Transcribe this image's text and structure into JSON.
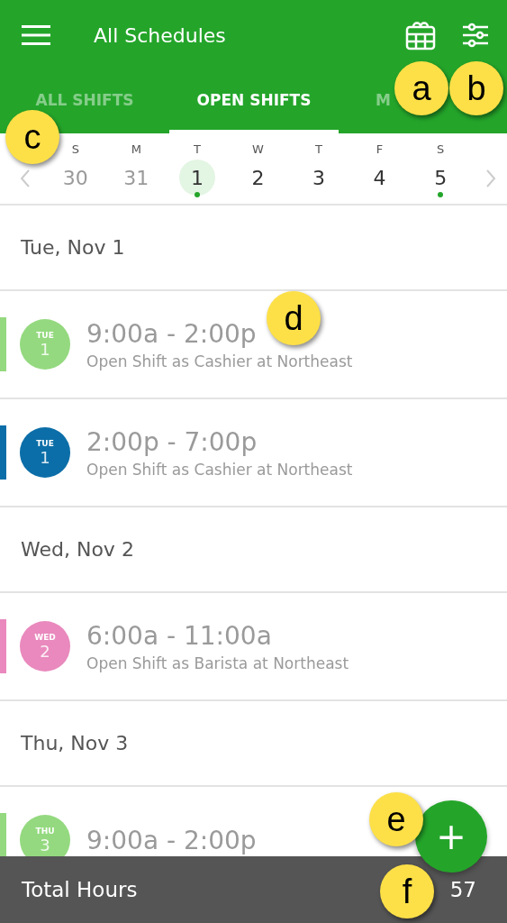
{
  "app_bar": {
    "title": "All Schedules"
  },
  "tabs": [
    {
      "label": "ALL SHIFTS",
      "selected": false
    },
    {
      "label": "OPEN SHIFTS",
      "selected": true
    },
    {
      "label": "M",
      "selected": false
    }
  ],
  "week": [
    {
      "letter": "S",
      "day": "30",
      "past": true,
      "selected": false,
      "has_shift": false
    },
    {
      "letter": "M",
      "day": "31",
      "past": true,
      "selected": false,
      "has_shift": false
    },
    {
      "letter": "T",
      "day": "1",
      "past": false,
      "selected": true,
      "has_shift": true
    },
    {
      "letter": "W",
      "day": "2",
      "past": false,
      "selected": false,
      "has_shift": false
    },
    {
      "letter": "T",
      "day": "3",
      "past": false,
      "selected": false,
      "has_shift": false
    },
    {
      "letter": "F",
      "day": "4",
      "past": false,
      "selected": false,
      "has_shift": false
    },
    {
      "letter": "S",
      "day": "5",
      "past": false,
      "selected": false,
      "has_shift": true
    }
  ],
  "days": [
    {
      "heading": "Tue, Nov 1",
      "shifts": [
        {
          "weekday": "TUE",
          "date": "1",
          "color": "#94d97f",
          "time": "9:00a - 2:00p",
          "detail": "Open Shift as Cashier at Northeast"
        },
        {
          "weekday": "TUE",
          "date": "1",
          "color": "#0b6ea8",
          "time": "2:00p - 7:00p",
          "detail": "Open Shift as Cashier at Northeast"
        }
      ]
    },
    {
      "heading": "Wed, Nov 2",
      "shifts": [
        {
          "weekday": "WED",
          "date": "2",
          "color": "#e989bd",
          "time": "6:00a - 11:00a",
          "detail": "Open Shift as Barista at Northeast"
        }
      ]
    },
    {
      "heading": "Thu, Nov 3",
      "shifts": [
        {
          "weekday": "THU",
          "date": "3",
          "color": "#94d97f",
          "time": "9:00a - 2:00p"
        }
      ]
    }
  ],
  "add_button": {
    "symbol": "+"
  },
  "footer": {
    "label": "Total Hours",
    "value": "57"
  },
  "callouts": [
    {
      "letter": "a",
      "kind": "a"
    },
    {
      "letter": "b",
      "kind": "b"
    },
    {
      "letter": "c",
      "kind": "c"
    },
    {
      "letter": "d",
      "kind": "d"
    },
    {
      "letter": "e",
      "kind": "e"
    },
    {
      "letter": "f",
      "kind": "f"
    }
  ]
}
